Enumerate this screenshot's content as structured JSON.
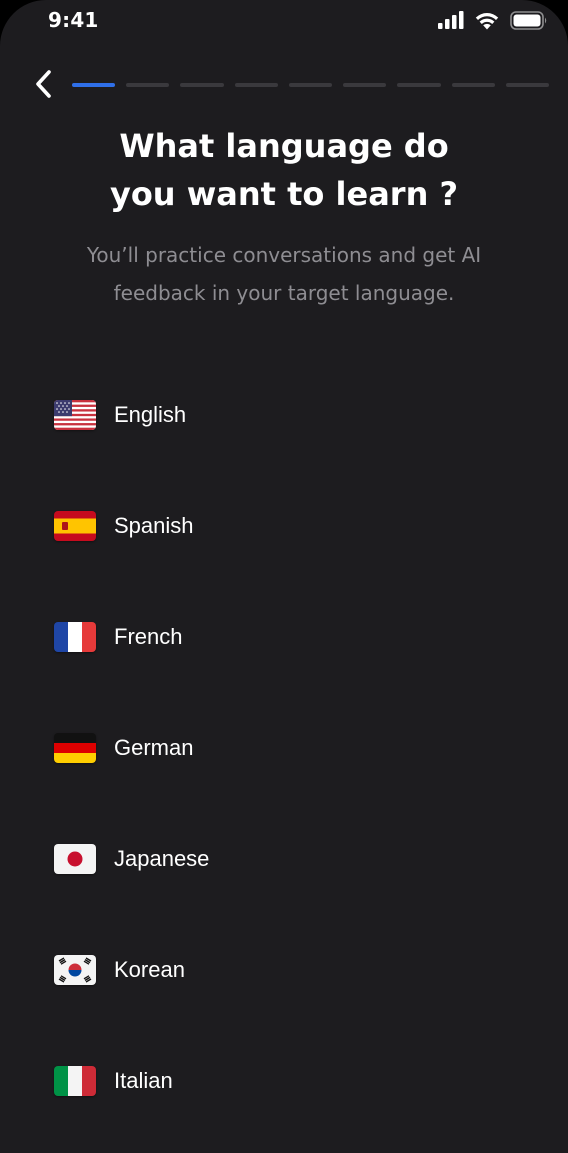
{
  "status_bar": {
    "time": "9:41",
    "icons": [
      "signal-icon",
      "wifi-icon",
      "battery-icon"
    ]
  },
  "header": {
    "back_icon": "chevron-left-icon",
    "progress": {
      "current_step": 1,
      "total_steps": 9
    }
  },
  "title_lines": [
    "What language do",
    "you want to learn ?"
  ],
  "subtitle_lines": [
    "You’ll practice conversations and get AI",
    "feedback in your target language."
  ],
  "languages": [
    {
      "label": "English",
      "flag": "us-flag-icon"
    },
    {
      "label": "Spanish",
      "flag": "spain-flag-icon"
    },
    {
      "label": "French",
      "flag": "france-flag-icon"
    },
    {
      "label": "German",
      "flag": "germany-flag-icon"
    },
    {
      "label": "Japanese",
      "flag": "japan-flag-icon"
    },
    {
      "label": "Korean",
      "flag": "korea-flag-icon"
    },
    {
      "label": "Italian",
      "flag": "italy-flag-icon"
    }
  ],
  "colors": {
    "background": "#1d1c1f",
    "accent": "#2f6fe8",
    "inactive_progress": "#3a393d",
    "subtitle_text": "#8e8d92",
    "text": "#ffffff"
  }
}
